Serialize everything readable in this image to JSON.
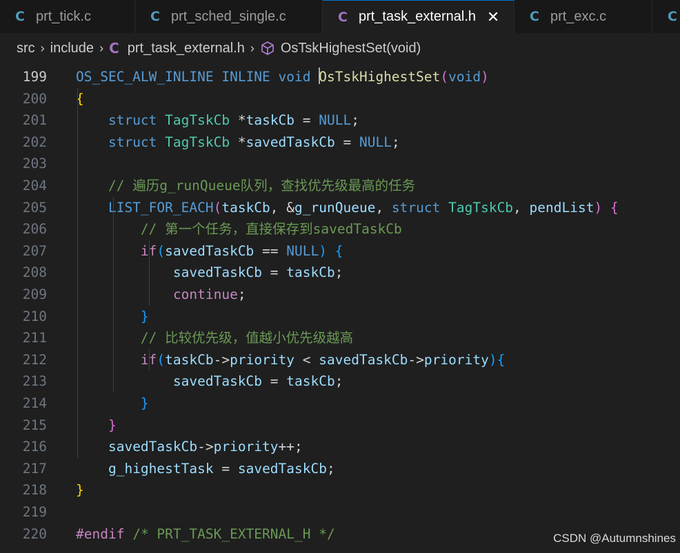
{
  "tabs": [
    {
      "icon": "C",
      "label": "prt_tick.c"
    },
    {
      "icon": "C",
      "label": "prt_sched_single.c"
    },
    {
      "icon": "C",
      "label": "prt_task_external.h",
      "active": true
    },
    {
      "icon": "C",
      "label": "prt_exc.c"
    },
    {
      "icon": "C",
      "label": ""
    }
  ],
  "close_glyph": "✕",
  "breadcrumb": {
    "parts": [
      "src",
      "include"
    ],
    "separator": "›",
    "file_icon": "C",
    "file": "prt_task_external.h",
    "symbol_icon": "symbol-method-icon",
    "symbol": "OsTskHighestSet(void)"
  },
  "lines": [
    {
      "n": "199",
      "current": true,
      "tokens": [
        {
          "t": "OS_SEC_ALW_INLINE",
          "c": "mac"
        },
        {
          "t": " "
        },
        {
          "t": "INLINE",
          "c": "mac"
        },
        {
          "t": " "
        },
        {
          "t": "void",
          "c": "kw"
        },
        {
          "t": " "
        },
        {
          "cursor": true
        },
        {
          "t": "OsTskHighestSet",
          "c": "fn"
        },
        {
          "t": "(",
          "c": "p2"
        },
        {
          "t": "void",
          "c": "kw"
        },
        {
          "t": ")",
          "c": "p2"
        }
      ]
    },
    {
      "n": "200",
      "tokens": [
        {
          "t": "{",
          "c": "p1"
        }
      ]
    },
    {
      "n": "201",
      "tokens": [
        {
          "t": "    "
        },
        {
          "t": "struct",
          "c": "kw"
        },
        {
          "t": " "
        },
        {
          "t": "TagTskCb",
          "c": "ty"
        },
        {
          "t": " "
        },
        {
          "t": "*",
          "c": "op"
        },
        {
          "t": "taskCb",
          "c": "var"
        },
        {
          "t": " "
        },
        {
          "t": "=",
          "c": "op"
        },
        {
          "t": " "
        },
        {
          "t": "NULL",
          "c": "mac"
        },
        {
          "t": ";",
          "c": "op"
        }
      ]
    },
    {
      "n": "202",
      "tokens": [
        {
          "t": "    "
        },
        {
          "t": "struct",
          "c": "kw"
        },
        {
          "t": " "
        },
        {
          "t": "TagTskCb",
          "c": "ty"
        },
        {
          "t": " "
        },
        {
          "t": "*",
          "c": "op"
        },
        {
          "t": "savedTaskCb",
          "c": "var"
        },
        {
          "t": " "
        },
        {
          "t": "=",
          "c": "op"
        },
        {
          "t": " "
        },
        {
          "t": "NULL",
          "c": "mac"
        },
        {
          "t": ";",
          "c": "op"
        }
      ]
    },
    {
      "n": "203",
      "tokens": []
    },
    {
      "n": "204",
      "tokens": [
        {
          "t": "    "
        },
        {
          "t": "// 遍历g_runQueue队列，查找优先级最高的任务",
          "c": "cm"
        }
      ]
    },
    {
      "n": "205",
      "tokens": [
        {
          "t": "    "
        },
        {
          "t": "LIST_FOR_EACH",
          "c": "mac"
        },
        {
          "t": "(",
          "c": "p2"
        },
        {
          "t": "taskCb",
          "c": "var"
        },
        {
          "t": ", ",
          "c": "op"
        },
        {
          "t": "&",
          "c": "op"
        },
        {
          "t": "g_runQueue",
          "c": "var"
        },
        {
          "t": ", ",
          "c": "op"
        },
        {
          "t": "struct",
          "c": "kw"
        },
        {
          "t": " "
        },
        {
          "t": "TagTskCb",
          "c": "ty"
        },
        {
          "t": ", ",
          "c": "op"
        },
        {
          "t": "pendList",
          "c": "var"
        },
        {
          "t": ")",
          "c": "p2"
        },
        {
          "t": " "
        },
        {
          "t": "{",
          "c": "p2"
        }
      ]
    },
    {
      "n": "206",
      "tokens": [
        {
          "t": "        "
        },
        {
          "t": "// 第一个任务，直接保存到savedTaskCb",
          "c": "cm"
        }
      ]
    },
    {
      "n": "207",
      "tokens": [
        {
          "t": "        "
        },
        {
          "t": "if",
          "c": "ctl"
        },
        {
          "t": "(",
          "c": "p3"
        },
        {
          "t": "savedTaskCb",
          "c": "var"
        },
        {
          "t": " "
        },
        {
          "t": "==",
          "c": "op"
        },
        {
          "t": " "
        },
        {
          "t": "NULL",
          "c": "mac"
        },
        {
          "t": ")",
          "c": "p3"
        },
        {
          "t": " "
        },
        {
          "t": "{",
          "c": "p3"
        }
      ]
    },
    {
      "n": "208",
      "tokens": [
        {
          "t": "            "
        },
        {
          "t": "savedTaskCb",
          "c": "var"
        },
        {
          "t": " "
        },
        {
          "t": "=",
          "c": "op"
        },
        {
          "t": " "
        },
        {
          "t": "taskCb",
          "c": "var"
        },
        {
          "t": ";",
          "c": "op"
        }
      ]
    },
    {
      "n": "209",
      "tokens": [
        {
          "t": "            "
        },
        {
          "t": "continue",
          "c": "ctl"
        },
        {
          "t": ";",
          "c": "op"
        }
      ]
    },
    {
      "n": "210",
      "tokens": [
        {
          "t": "        "
        },
        {
          "t": "}",
          "c": "p3"
        }
      ]
    },
    {
      "n": "211",
      "tokens": [
        {
          "t": "        "
        },
        {
          "t": "// 比较优先级，值越小优先级越高",
          "c": "cm"
        }
      ]
    },
    {
      "n": "212",
      "tokens": [
        {
          "t": "        "
        },
        {
          "t": "if",
          "c": "ctl"
        },
        {
          "t": "(",
          "c": "p3"
        },
        {
          "t": "taskCb",
          "c": "var"
        },
        {
          "t": "->",
          "c": "op"
        },
        {
          "t": "priority",
          "c": "var"
        },
        {
          "t": " "
        },
        {
          "t": "<",
          "c": "op"
        },
        {
          "t": " "
        },
        {
          "t": "savedTaskCb",
          "c": "var"
        },
        {
          "t": "->",
          "c": "op"
        },
        {
          "t": "priority",
          "c": "var"
        },
        {
          "t": ")",
          "c": "p3"
        },
        {
          "t": "{",
          "c": "p3"
        }
      ]
    },
    {
      "n": "213",
      "tokens": [
        {
          "t": "            "
        },
        {
          "t": "savedTaskCb",
          "c": "var"
        },
        {
          "t": " "
        },
        {
          "t": "=",
          "c": "op"
        },
        {
          "t": " "
        },
        {
          "t": "taskCb",
          "c": "var"
        },
        {
          "t": ";",
          "c": "op"
        }
      ]
    },
    {
      "n": "214",
      "tokens": [
        {
          "t": "        "
        },
        {
          "t": "}",
          "c": "p3"
        }
      ]
    },
    {
      "n": "215",
      "tokens": [
        {
          "t": "    "
        },
        {
          "t": "}",
          "c": "p2"
        }
      ]
    },
    {
      "n": "216",
      "tokens": [
        {
          "t": "    "
        },
        {
          "t": "savedTaskCb",
          "c": "var"
        },
        {
          "t": "->",
          "c": "op"
        },
        {
          "t": "priority",
          "c": "var"
        },
        {
          "t": "++;",
          "c": "op"
        }
      ]
    },
    {
      "n": "217",
      "tokens": [
        {
          "t": "    "
        },
        {
          "t": "g_highestTask",
          "c": "var"
        },
        {
          "t": " "
        },
        {
          "t": "=",
          "c": "op"
        },
        {
          "t": " "
        },
        {
          "t": "savedTaskCb",
          "c": "var"
        },
        {
          "t": ";",
          "c": "op"
        }
      ]
    },
    {
      "n": "218",
      "tokens": [
        {
          "t": "}",
          "c": "p1"
        }
      ]
    },
    {
      "n": "219",
      "tokens": []
    },
    {
      "n": "220",
      "tokens": [
        {
          "t": "#endif",
          "c": "ctl"
        },
        {
          "t": " "
        },
        {
          "t": "/* PRT_TASK_EXTERNAL_H */",
          "c": "cm"
        }
      ]
    }
  ],
  "watermark": "CSDN @Autumnshines",
  "colors": {
    "editor_bg": "#1f1f1f",
    "tab_bg": "#181818",
    "c_icon": "#519aba",
    "h_icon": "#a074c4",
    "keyword": "#569cd6",
    "control": "#c586c0",
    "function": "#dcdcaa",
    "type": "#4ec9b0",
    "variable": "#9cdcfe",
    "comment": "#6a9955"
  }
}
